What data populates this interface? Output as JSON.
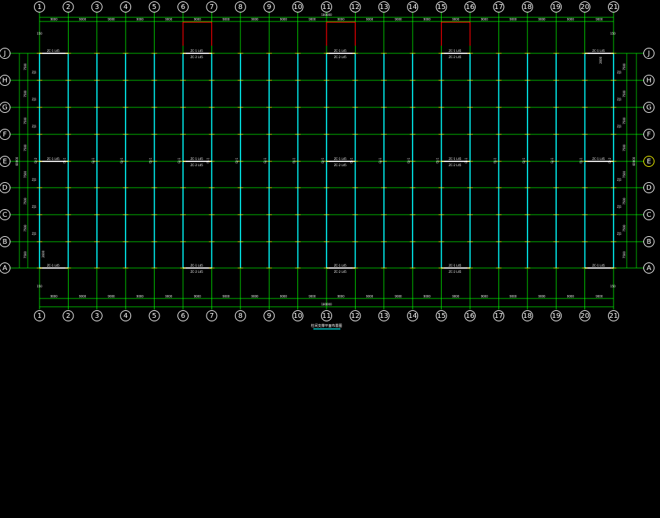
{
  "colors": {
    "background": "#000000",
    "grid_line": "#00ff00",
    "column_member": "#00ffff",
    "bracing": "#ffffff",
    "dim_line": "#00ff00",
    "highlight_bubble": "#ffff00",
    "red_member": "#ff0000",
    "title_underline": "#00ffff",
    "text": "#ffffff"
  },
  "grid": {
    "column_labels": [
      "1",
      "2",
      "3",
      "4",
      "5",
      "6",
      "7",
      "8",
      "9",
      "10",
      "11",
      "12",
      "13",
      "14",
      "15",
      "16",
      "17",
      "18",
      "19",
      "20",
      "21"
    ],
    "row_labels": [
      "J",
      "H",
      "G",
      "F",
      "E",
      "D",
      "C",
      "B",
      "A"
    ],
    "highlighted_row": "E"
  },
  "dimensions": {
    "total_top": "180000",
    "total_bottom": "180000",
    "bay_spacing_top": [
      "9000",
      "9000",
      "9000",
      "9000",
      "9000",
      "9000",
      "9000",
      "9000",
      "9000",
      "9000",
      "9000",
      "9000",
      "9000",
      "9000",
      "9000",
      "9000",
      "9000",
      "9000",
      "9000",
      "9000"
    ],
    "bay_spacing_bottom": [
      "9000",
      "9000",
      "9000",
      "9000",
      "9000",
      "9000",
      "9000",
      "9000",
      "9000",
      "9000",
      "9000",
      "9000",
      "9000",
      "9000",
      "9000",
      "9000",
      "9000",
      "9000",
      "9000",
      "9000"
    ],
    "side_total_left": "60000",
    "side_total_right": "60000",
    "side_spacing": [
      "7500",
      "7500",
      "7500",
      "7500",
      "7500",
      "7500",
      "7500",
      "7500"
    ],
    "edge_offset": "150"
  },
  "labels": {
    "bracing_top": "ZC-1 L45",
    "bracing_top_second": "ZC-2 L45",
    "bracing_middle": "ZC-1 L45",
    "bracing_bottom": "ZC-1 L45",
    "bracing_bottom_second": "ZC-2 L45",
    "tie_label": "ZJ1",
    "column_label": "GJ-1",
    "end_column_label": "GJ-2",
    "end_mark": "2600"
  },
  "title": "柱间支撑平面布置图"
}
